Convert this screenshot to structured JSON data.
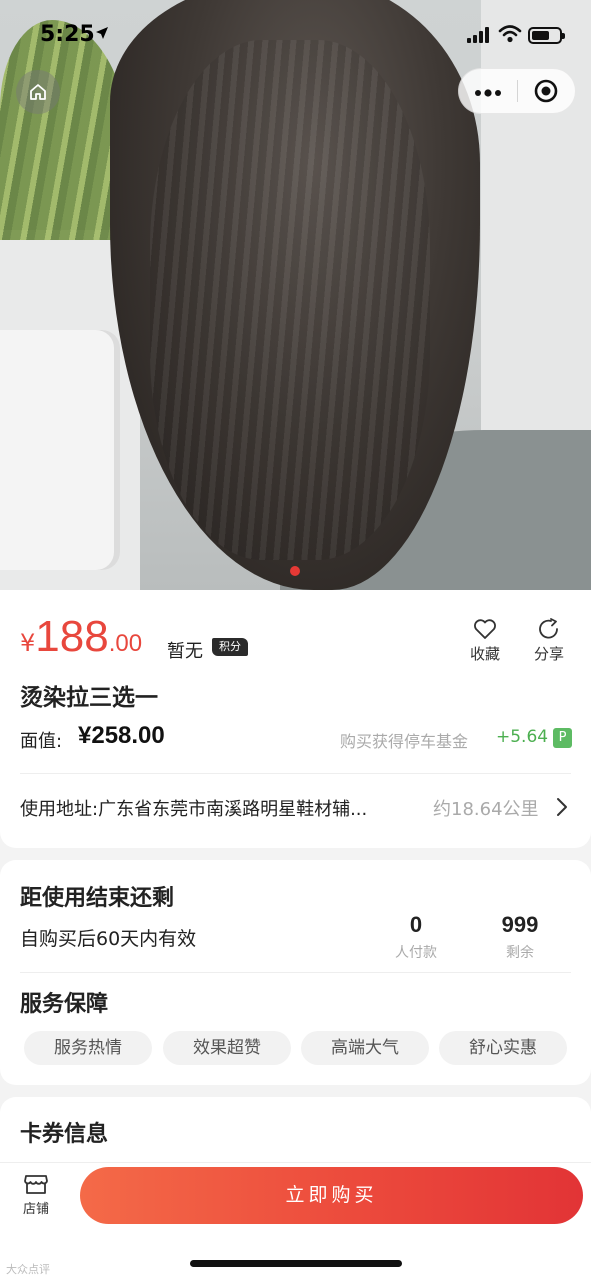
{
  "status_bar": {
    "time": "5:25"
  },
  "product": {
    "price_symbol": "¥",
    "price_integer": "188",
    "price_decimal": ".00",
    "points_text": "暂无",
    "points_tag": "积分",
    "favorite_label": "收藏",
    "share_label": "分享",
    "title": "烫染拉三选一",
    "face_value_label": "面值:",
    "face_value": "¥258.00",
    "parking_text": "购买获得停车基金",
    "parking_value": "+5.64",
    "parking_badge": "P",
    "address": "使用地址:广东省东莞市南溪路明星鞋材辅...",
    "distance": "约18.64公里"
  },
  "validity": {
    "heading": "距使用结束还剩",
    "text": "自购买后60天内有效",
    "paid_count": "0",
    "paid_label": "人付款",
    "remaining_count": "999",
    "remaining_label": "剩余"
  },
  "service": {
    "heading": "服务保障",
    "tags": [
      "服务热情",
      "效果超赞",
      "高端大气",
      "舒心实惠"
    ]
  },
  "coupon": {
    "heading": "卡券信息"
  },
  "bottom_bar": {
    "store_label": "店铺",
    "buy_label": "立即购买"
  },
  "watermark": "大众点评",
  "colors": {
    "price": "#e8473d",
    "buy_button": "#ec4a3c",
    "parking_green": "#4caf50"
  }
}
